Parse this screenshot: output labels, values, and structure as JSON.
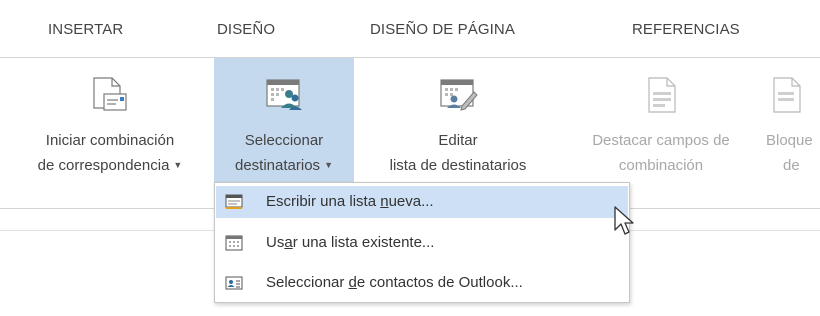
{
  "tabs": [
    {
      "label": "INSERTAR"
    },
    {
      "label": "DISEÑO"
    },
    {
      "label": "DISEÑO DE PÁGINA"
    },
    {
      "label": "REFERENCIAS"
    }
  ],
  "ribbon": {
    "start_merge": {
      "line1": "Iniciar combinación",
      "line2": "de correspondencia",
      "icon": "start-mail-merge-icon"
    },
    "select_recipients": {
      "line1": "Seleccionar",
      "line2": "destinatarios",
      "icon": "select-recipients-icon",
      "state": "pressed"
    },
    "edit_list": {
      "line1": "Editar",
      "line2": "lista de destinatarios",
      "icon": "edit-recipient-list-icon"
    },
    "highlight_fields": {
      "line1": "Destacar campos de",
      "line2": "combinación",
      "icon": "highlight-merge-fields-icon",
      "state": "disabled"
    },
    "address_block": {
      "line1": "Bloque",
      "line2": "de",
      "icon": "address-block-icon",
      "state": "disabled"
    }
  },
  "dropdown": {
    "items": [
      {
        "prefix": "Escribir una lista ",
        "mnemonic": "n",
        "suffix": "ueva...",
        "icon": "type-new-list-icon",
        "state": "hover"
      },
      {
        "prefix": "Us",
        "mnemonic": "a",
        "suffix": "r una lista existente...",
        "icon": "use-existing-list-icon"
      },
      {
        "prefix": "Seleccionar ",
        "mnemonic": "d",
        "suffix": "e contactos de Outlook...",
        "icon": "outlook-contacts-icon"
      }
    ]
  },
  "colors": {
    "pressed_button": "#c5d9ee",
    "menu_hover": "#cde0f5",
    "disabled_text": "#a8a8a8"
  }
}
